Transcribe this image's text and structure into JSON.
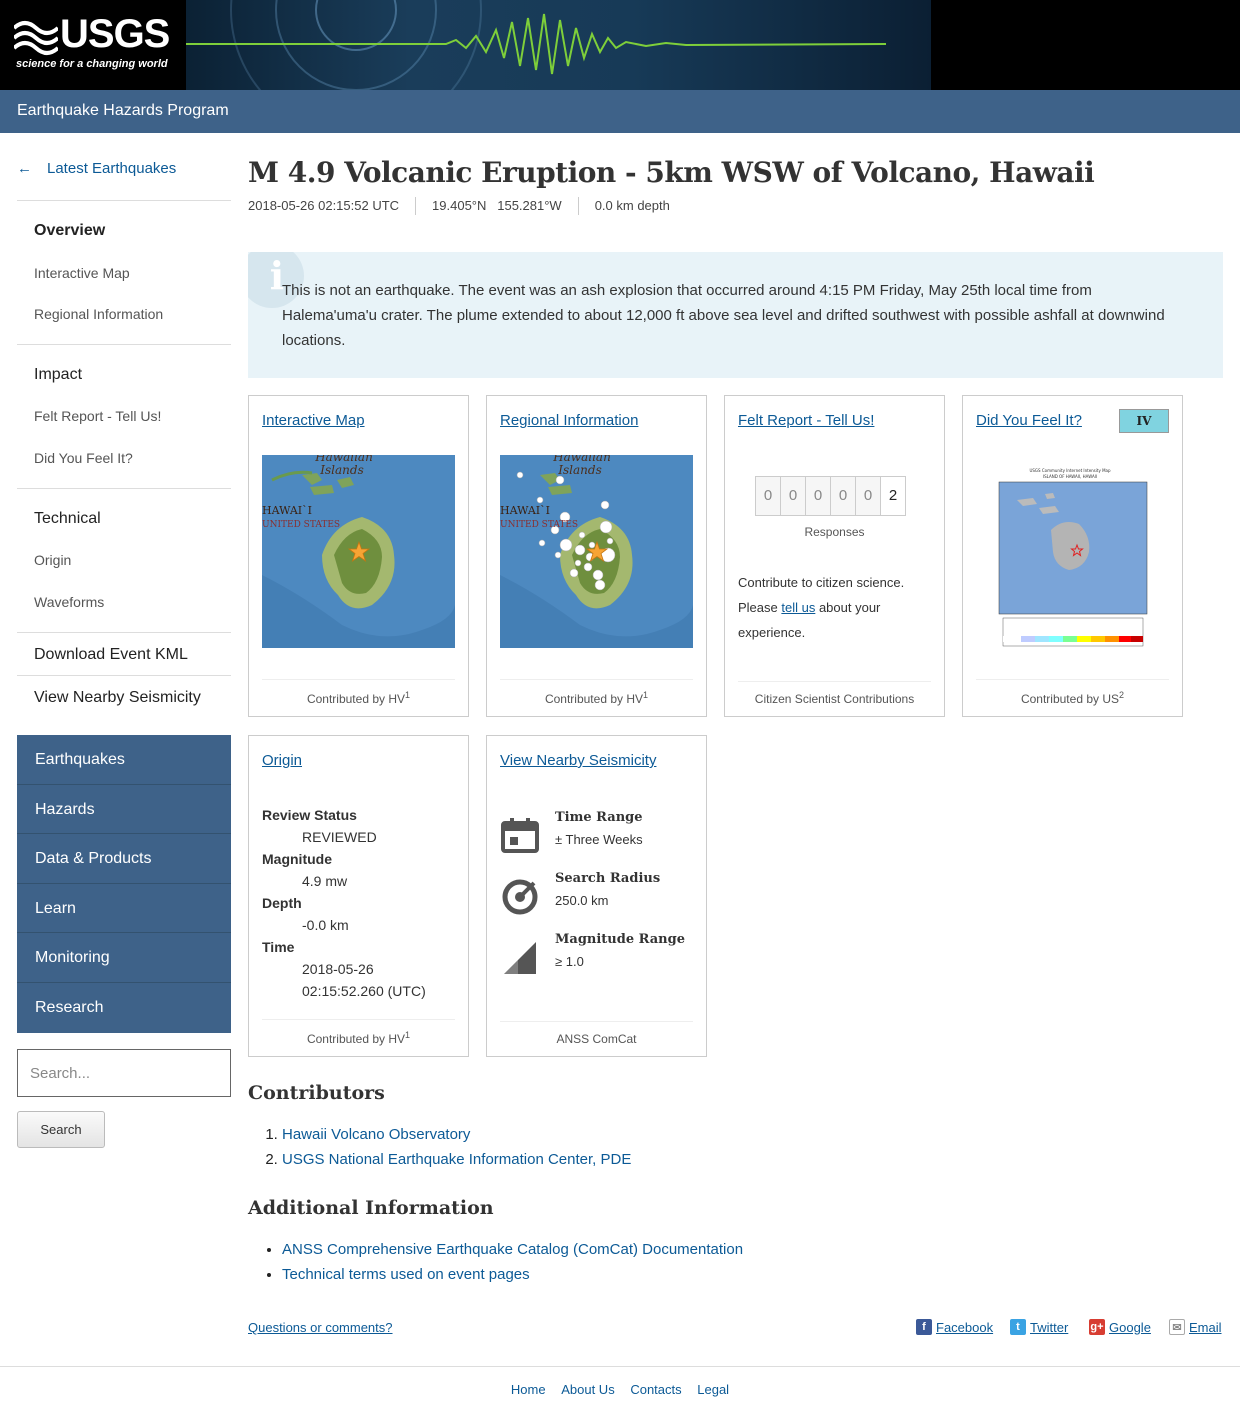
{
  "header": {
    "logo_text": "USGS",
    "logo_tagline": "science for a changing world",
    "program": "Earthquake Hazards Program"
  },
  "sidebar": {
    "back_label": "Latest Earthquakes",
    "items": {
      "overview": "Overview",
      "interactive_map": "Interactive Map",
      "regional_information": "Regional Information",
      "impact": "Impact",
      "felt_report": "Felt Report - Tell Us!",
      "dyfi": "Did You Feel It?",
      "technical": "Technical",
      "origin": "Origin",
      "waveforms": "Waveforms",
      "download_kml": "Download Event KML",
      "nearby_seismicity": "View Nearby Seismicity"
    },
    "nav": [
      "Earthquakes",
      "Hazards",
      "Data & Products",
      "Learn",
      "Monitoring",
      "Research"
    ],
    "search_placeholder": "Search...",
    "search_button": "Search"
  },
  "event": {
    "title": "M 4.9 Volcanic Eruption - 5km WSW of Volcano, Hawaii",
    "time": "2018-05-26 02:15:52 UTC",
    "location": "19.405°N   155.281°W",
    "depth": "0.0 km depth",
    "notice": "This is not an earthquake. The event was an ash explosion that occurred around 4:15 PM Friday, May 25th local time from Halema'uma'u crater. The plume extended to about 12,000 ft above sea level and drifted southwest with possible ashfall at downwind locations."
  },
  "cards": {
    "map": {
      "title": "Interactive Map",
      "foot": "Contributed by HV",
      "sup": "1",
      "map_label1": "Hawaiian",
      "map_label2": "Islands",
      "map_label3": "HAWAI`I",
      "map_label4": "UNITED STATES"
    },
    "regional": {
      "title": "Regional Information",
      "foot": "Contributed by HV",
      "sup": "1"
    },
    "felt": {
      "title": "Felt Report - Tell Us!",
      "digits": [
        "0",
        "0",
        "0",
        "0",
        "0",
        "2"
      ],
      "responses_label": "Responses",
      "text_before": "Contribute to citizen science. Please ",
      "link": "tell us",
      "text_after": " about your experience.",
      "foot": "Citizen Scientist Contributions"
    },
    "dyfi": {
      "title": "Did You Feel It?",
      "mmi": "IV",
      "foot": "Contributed by US",
      "sup": "2",
      "map_title": "USGS Community Internet Intensity Map",
      "map_subtitle": "ISLAND OF HAWAII, HAWAII"
    },
    "origin": {
      "title": "Origin",
      "fields": [
        {
          "label": "Review Status",
          "value": "REVIEWED"
        },
        {
          "label": "Magnitude",
          "value": "4.9 mw"
        },
        {
          "label": "Depth",
          "value": "-0.0 km"
        },
        {
          "label": "Time",
          "value": "2018-05-26",
          "value2": "02:15:52.260 (UTC)"
        }
      ],
      "foot": "Contributed by HV",
      "sup": "1"
    },
    "seismicity": {
      "title": "View Nearby Seismicity",
      "rows": [
        {
          "label": "Time Range",
          "value": "± Three Weeks",
          "icon": "calendar-icon"
        },
        {
          "label": "Search Radius",
          "value": "250.0 km",
          "icon": "radius-icon"
        },
        {
          "label": "Magnitude Range",
          "value": "≥ 1.0",
          "icon": "magnitude-icon"
        }
      ],
      "foot": "ANSS ComCat"
    }
  },
  "contributors": {
    "heading": "Contributors",
    "items": [
      "Hawaii Volcano Observatory",
      "USGS National Earthquake Information Center, PDE"
    ]
  },
  "additional": {
    "heading": "Additional Information",
    "items": [
      "ANSS Comprehensive Earthquake Catalog (ComCat) Documentation",
      "Technical terms used on event pages"
    ]
  },
  "share": {
    "questions": "Questions or comments?",
    "facebook": "Facebook",
    "twitter": "Twitter",
    "google": "Google",
    "email": "Email"
  },
  "footer": [
    "Home",
    "About Us",
    "Contacts",
    "Legal"
  ],
  "colors": {
    "header_blue": "#3e6289",
    "link": "#0c5a96",
    "info_bg": "#e8f3f8",
    "mmi_iv": "#80d3e0"
  }
}
